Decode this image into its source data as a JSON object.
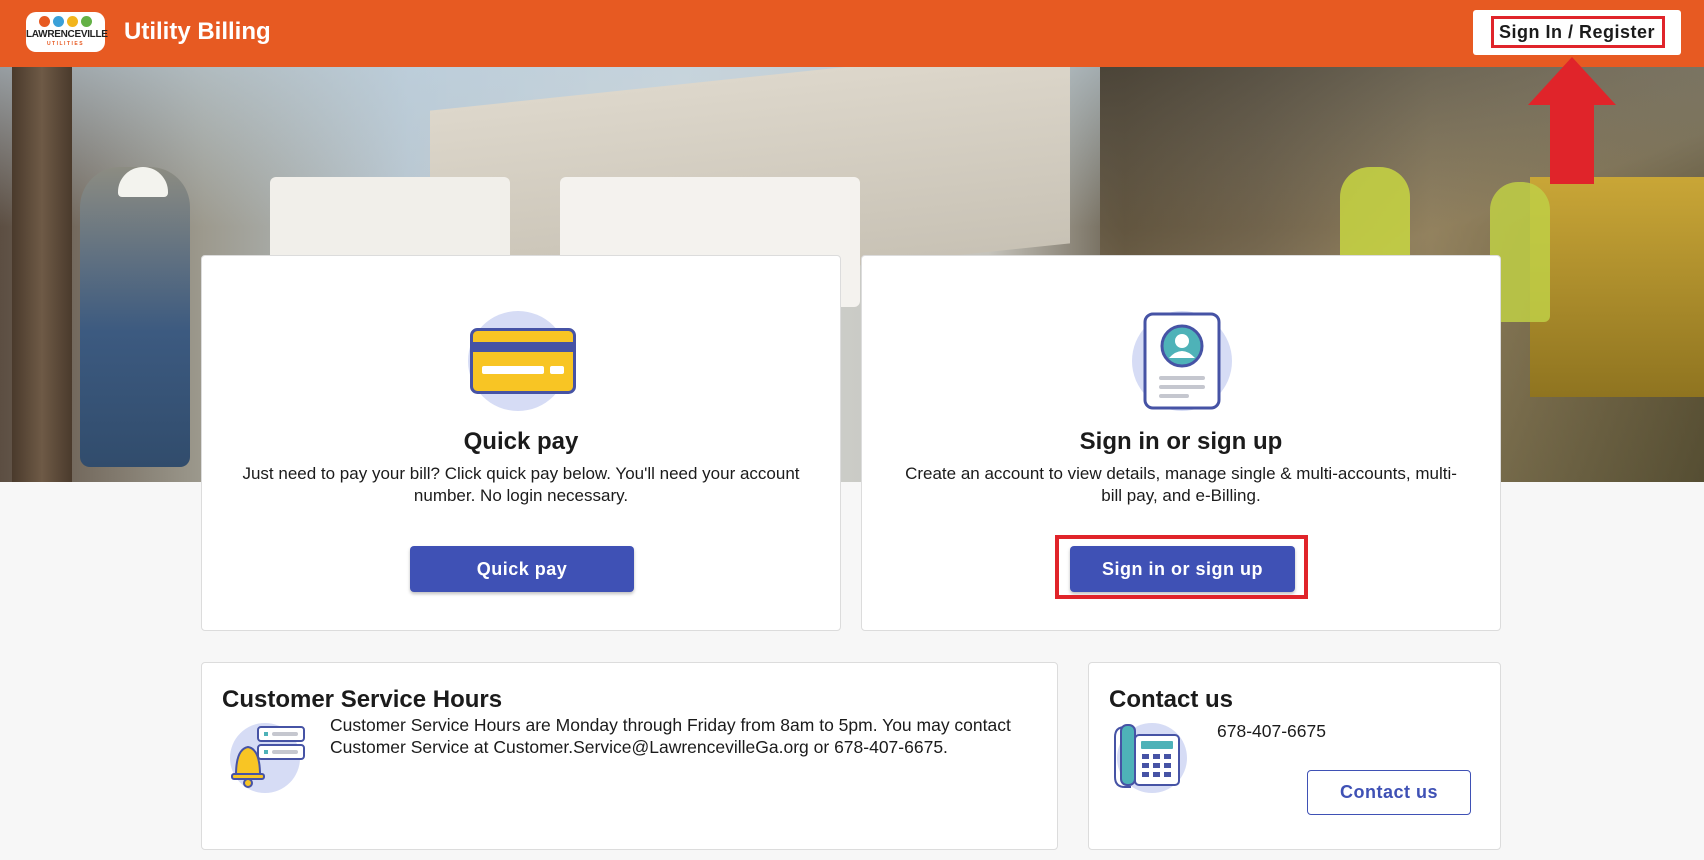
{
  "header": {
    "logo_name": "LAWRENCEVILLE",
    "logo_sub": "UTILITIES",
    "title": "Utility Billing",
    "signin_label": "Sign In / Register",
    "brand_color": "#e75a22"
  },
  "quick_pay": {
    "title": "Quick pay",
    "description": "Just need to pay your bill? Click quick pay below. You'll need your account number. No login necessary.",
    "button_label": "Quick pay",
    "icon": "credit-card-icon"
  },
  "sign_in": {
    "title": "Sign in or sign up",
    "description": "Create an account to view details, manage single & multi-accounts, multi-bill pay, and e-Billing.",
    "button_label": "Sign in or sign up",
    "icon": "user-profile-document-icon"
  },
  "hours": {
    "title": "Customer Service Hours",
    "text": "Customer Service Hours are Monday through Friday from 8am to 5pm. You may contact Customer Service at Customer.Service@LawrencevilleGa.org or 678-407-6675.",
    "icon": "bell-notification-icon"
  },
  "contact": {
    "title": "Contact us",
    "phone": "678-407-6675",
    "button_label": "Contact us",
    "icon": "telephone-icon"
  },
  "colors": {
    "primary": "#3f51b5",
    "highlight": "#e0242a",
    "icon_bg": "#d6dcf5"
  }
}
